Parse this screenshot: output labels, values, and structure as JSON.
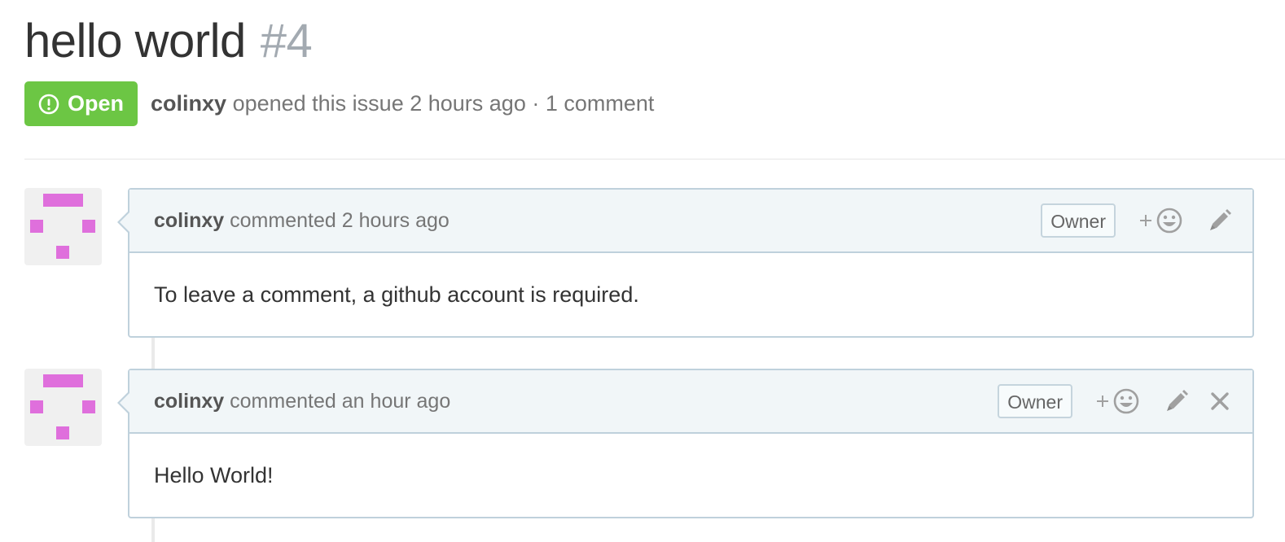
{
  "issue": {
    "title": "hello world",
    "number": "#4",
    "state": {
      "label": "Open",
      "icon": "issue-opened-icon",
      "color": "#6cc644"
    },
    "author": "colinxy",
    "meta_action": "opened this issue",
    "opened_time": "2 hours ago",
    "separator": "·",
    "comment_count": "1 comment"
  },
  "comments": [
    {
      "author": "colinxy",
      "action": "commented",
      "time": "2 hours ago",
      "badge": "Owner",
      "body": "To leave a comment, a github account is required.",
      "avatar_color": "#df6fdc",
      "actions": [
        "add-reaction-icon",
        "pencil-icon"
      ]
    },
    {
      "author": "colinxy",
      "action": "commented",
      "time": "an hour ago",
      "badge": "Owner",
      "body": "Hello World!",
      "avatar_color": "#df6fdc",
      "actions": [
        "add-reaction-icon",
        "pencil-icon",
        "close-icon"
      ]
    }
  ],
  "colors": {
    "border": "#bfd1dc",
    "header_bg": "#f1f6f8",
    "muted_text": "#767676",
    "number_text": "#a3aab1"
  }
}
